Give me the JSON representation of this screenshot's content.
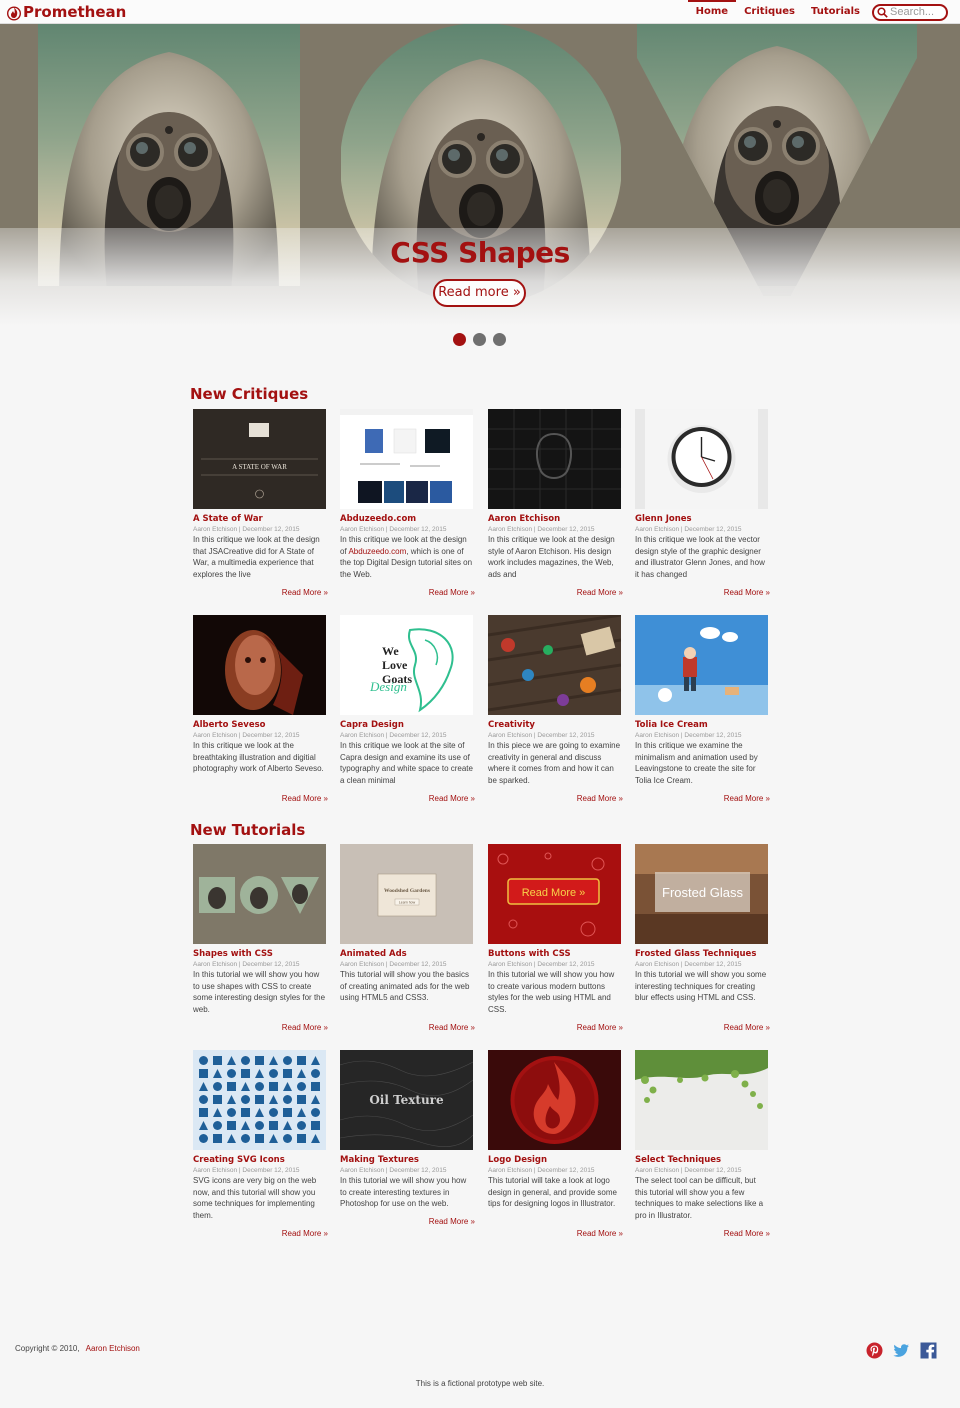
{
  "header": {
    "logo_text": "Promethean",
    "nav": [
      {
        "label": "Home",
        "active": true
      },
      {
        "label": "Critiques",
        "active": false
      },
      {
        "label": "Tutorials",
        "active": false
      }
    ],
    "search_placeholder": "Search..."
  },
  "hero": {
    "title": "CSS Shapes",
    "button_label": "Read more »",
    "slides_count": 3,
    "active_slide": 1
  },
  "critiques": {
    "title": "New Critiques",
    "items": [
      {
        "title": "A State of War",
        "meta": "Aaron Etchison | December 12, 2015",
        "desc": "In this critique we look at the design that JSACreative did for A State of War, a multimedia experience that explores the live",
        "more": "Read More »"
      },
      {
        "title": "Abduzeedo.com",
        "meta": "Aaron Etchison | December 12, 2015",
        "desc_pre": "In this critique we look at the design of ",
        "desc_link": "Abduzeedo.com",
        "desc_post": ", which is one of the top Digital Design tutorial sites on the Web.",
        "more": "Read More »"
      },
      {
        "title": "Aaron Etchison",
        "meta": "Aaron Etchison | December 12, 2015",
        "desc": "In this critique we look at the design style of Aaron Etchison. His design work includes magazines, the Web, ads and",
        "more": "Read More »"
      },
      {
        "title": "Glenn Jones",
        "meta": "Aaron Etchison | December 12, 2015",
        "desc": "In this critique we look at the vector design style of the graphic designer and illustrator Glenn Jones, and how it has changed",
        "more": "Read More »"
      },
      {
        "title": "Alberto Seveso",
        "meta": "Aaron Etchison | December 12, 2015",
        "desc": "In this critique we look at the breathtaking illustration and digitial photography work of Alberto Seveso.",
        "more": "Read More »"
      },
      {
        "title": "Capra Design",
        "meta": "Aaron Etchison | December 12, 2015",
        "desc": "In this critique we look at the site of Capra design and examine its use of typography and white space to create a clean minimal",
        "more": "Read More »"
      },
      {
        "title": "Creativity",
        "meta": "Aaron Etchison | December 12, 2015",
        "desc": "In this piece we are going to examine creativity in general and discuss where it comes from and how it can be sparked.",
        "more": "Read More »"
      },
      {
        "title": "Tolia Ice Cream",
        "meta": "Aaron Etchison | December 12, 2015",
        "desc": "In this critique we examine the minimalism and animation used by Leavingstone to create the site for Tolia Ice Cream.",
        "more": "Read More »"
      }
    ]
  },
  "tutorials": {
    "title": "New Tutorials",
    "items": [
      {
        "title": "Shapes with CSS",
        "meta": "Aaron Etchison | December 12, 2015",
        "desc": "In this tutorial we will show you how to use shapes with CSS to create some interesting design styles for the web.",
        "more": "Read More »"
      },
      {
        "title": "Animated Ads",
        "meta": "Aaron Etchison | December 12, 2015",
        "desc": "This tutorial will show you the basics of creating animated ads for the web using HTML5 and CSS3.",
        "more": "Read More »"
      },
      {
        "title": "Buttons with CSS",
        "meta": "Aaron Etchison | December 12, 2015",
        "desc": "In this tutorial we will show you how to create various modern buttons styles for the web using HTML and CSS.",
        "more": "Read More »"
      },
      {
        "title": "Frosted Glass Techniques",
        "meta": "Aaron Etchison | December 12, 2015",
        "desc": "In this tutorial we will show you some interesting techniques for creating blur effects using HTML and CSS.",
        "more": "Read More »"
      },
      {
        "title": "Creating SVG Icons",
        "meta": "Aaron Etchison | December 12, 2015",
        "desc": "SVG icons are very big on the web now, and this tutorial will show you some techniques for implementing them.",
        "more": "Read More »"
      },
      {
        "title": "Making Textures",
        "meta": "Aaron Etchison | December 12, 2015",
        "desc": "In this tutorial we will show you how to create interesting textures in Photoshop for use on the web.",
        "more": "Read More »"
      },
      {
        "title": "Logo Design",
        "meta": "Aaron Etchison | December 12, 2015",
        "desc": "This tutorial will take a look at logo design in general, and provide some tips for designing logos in Illustrator.",
        "more": "Read More »"
      },
      {
        "title": "Select Techniques",
        "meta": "Aaron Etchison | December 12, 2015",
        "desc": "The select tool can be difficult, but this tutorial will show you a few techniques to make selections like a pro in Illustrator.",
        "more": "Read More »"
      }
    ],
    "thumb_texts": {
      "animated_ads": "Woodshed Gardens",
      "animated_ads_sub": "Learn how",
      "buttons": "Read More »",
      "frosted": "Frosted Glass",
      "oil": "Oil Texture"
    }
  },
  "thumb_texts": {
    "state_of_war": "A STATE OF WAR",
    "capra": [
      "We",
      "Love",
      "Goats",
      "Design"
    ]
  },
  "footer": {
    "copyright": "Copyright © 2010,",
    "author": "Aaron Etchison",
    "note": "This is a fictional prototype web site."
  },
  "social_icons": [
    "pinterest-icon",
    "twitter-icon",
    "facebook-icon"
  ],
  "colors": {
    "brand": "#a31111",
    "background": "#f6f6f6",
    "hero_bg": "#7f7868"
  }
}
